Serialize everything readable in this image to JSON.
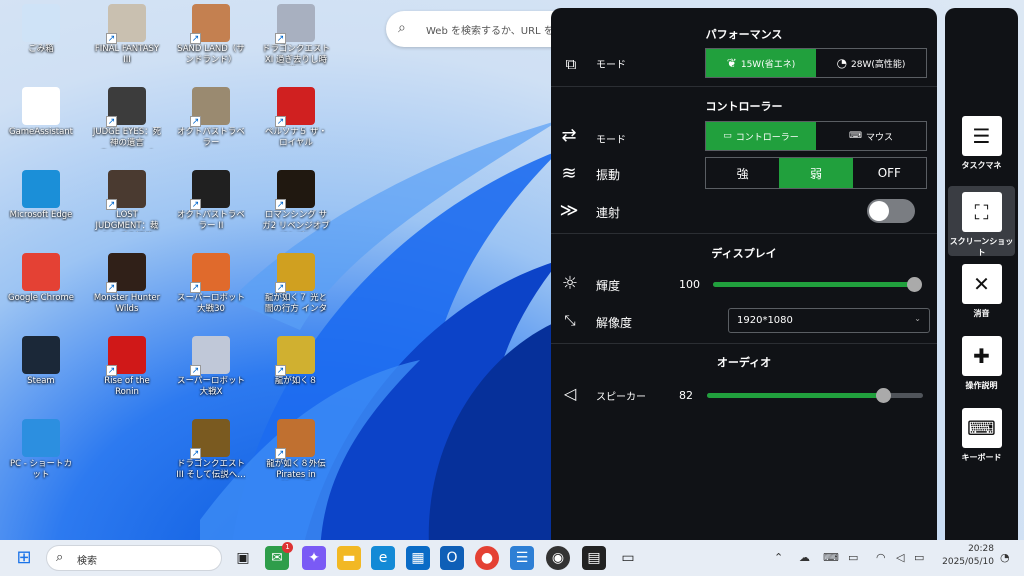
{
  "desktop_icons": [
    {
      "label": "ごみ箱",
      "icon": "recycle-bin-icon",
      "color": "#cfe3f7"
    },
    {
      "label": "GameAssistant",
      "icon": "gamepad-icon",
      "color": "#ffffff"
    },
    {
      "label": "Microsoft Edge",
      "icon": "edge-icon",
      "color": "#1b8fd8"
    },
    {
      "label": "Google Chrome",
      "icon": "chrome-icon",
      "color": "#e44134"
    },
    {
      "label": "Steam",
      "icon": "steam-icon",
      "color": "#1b2838"
    },
    {
      "label": "PC - ショートカット",
      "icon": "pc-icon",
      "color": "#2c8fe0"
    },
    {
      "label": "FINAL FANTASY III",
      "icon": "game-icon",
      "color": "#c9c0b0"
    },
    {
      "label": "JUDGE EYES：死神の遺言 Remastered",
      "icon": "game-icon",
      "color": "#3c3c3c"
    },
    {
      "label": "LOST JUDGMENT：裁かれざる記憶",
      "icon": "game-icon",
      "color": "#4a3a30"
    },
    {
      "label": "Monster Hunter Wilds",
      "icon": "game-icon",
      "color": "#302018"
    },
    {
      "label": "Rise of the Ronin",
      "icon": "game-icon",
      "color": "#d01818"
    },
    {
      "label": "SAND LAND（サンドランド）",
      "icon": "game-icon",
      "color": "#c48050"
    },
    {
      "label": "オクトパストラベラー",
      "icon": "game-icon",
      "color": "#9a8a70"
    },
    {
      "label": "オクトパストラベラー II",
      "icon": "game-icon",
      "color": "#202020"
    },
    {
      "label": "スーパーロボット大戦30",
      "icon": "game-icon",
      "color": "#e06a2c"
    },
    {
      "label": "スーパーロボット大戦X",
      "icon": "game-icon",
      "color": "#c0c8d8"
    },
    {
      "label": "ドラゴンクエストIII そして伝説へ…",
      "icon": "game-icon",
      "color": "#7a5a20"
    },
    {
      "label": "ドラゴンクエストXI 過ぎ去りし時を求め…",
      "icon": "game-icon",
      "color": "#a8b0c0"
    },
    {
      "label": "ペルソナ５ ザ・ロイヤル",
      "icon": "game-icon",
      "color": "#d02020"
    },
    {
      "label": "ロマンシング サガ2 リベンジオブザセブン",
      "icon": "game-icon",
      "color": "#201810"
    },
    {
      "label": "龍が如く７ 光と闇の行方 インターナ…",
      "icon": "game-icon",
      "color": "#d0a020"
    },
    {
      "label": "龍が如く８",
      "icon": "game-icon",
      "color": "#d0b030"
    },
    {
      "label": "龍が如く８外伝 Pirates in Hawaii",
      "icon": "game-icon",
      "color": "#c07030"
    }
  ],
  "browser_search": {
    "placeholder": "Web を検索するか、URL を"
  },
  "panel": {
    "performance": {
      "title": "パフォーマンス",
      "mode_label": "モード",
      "options": [
        "15W(省エネ)",
        "28W(高性能)"
      ],
      "selected": 0
    },
    "controller": {
      "title": "コントローラー",
      "mode_label": "モード",
      "options": [
        "コントローラー",
        "マウス"
      ],
      "selected": 0,
      "vibration_label": "振動",
      "vibration_options": [
        "強",
        "弱",
        "OFF"
      ],
      "vibration_selected": 1,
      "turbo_label": "連射",
      "turbo_on": false
    },
    "display": {
      "title": "ディスプレイ",
      "brightness_label": "輝度",
      "brightness_value": "100",
      "brightness_level": 100,
      "resolution_label": "解像度",
      "resolution_value": "1920*1080"
    },
    "audio": {
      "title": "オーディオ",
      "speaker_label": "スピーカー",
      "speaker_value": "82",
      "speaker_level": 82
    },
    "accent": "#21a03d"
  },
  "sidebar": [
    {
      "label": "タスクマネ",
      "icon": "sliders-icon"
    },
    {
      "label": "スクリーンショット",
      "icon": "screenshot-icon",
      "selected": true
    },
    {
      "label": "消音",
      "icon": "mute-icon"
    },
    {
      "label": "操作説明",
      "icon": "controller-guide-icon"
    },
    {
      "label": "キーボード",
      "icon": "keyboard-icon"
    }
  ],
  "taskbar": {
    "search_placeholder": "検索",
    "mail_badge": "1",
    "time": "20:28",
    "date": "2025/05/10"
  }
}
